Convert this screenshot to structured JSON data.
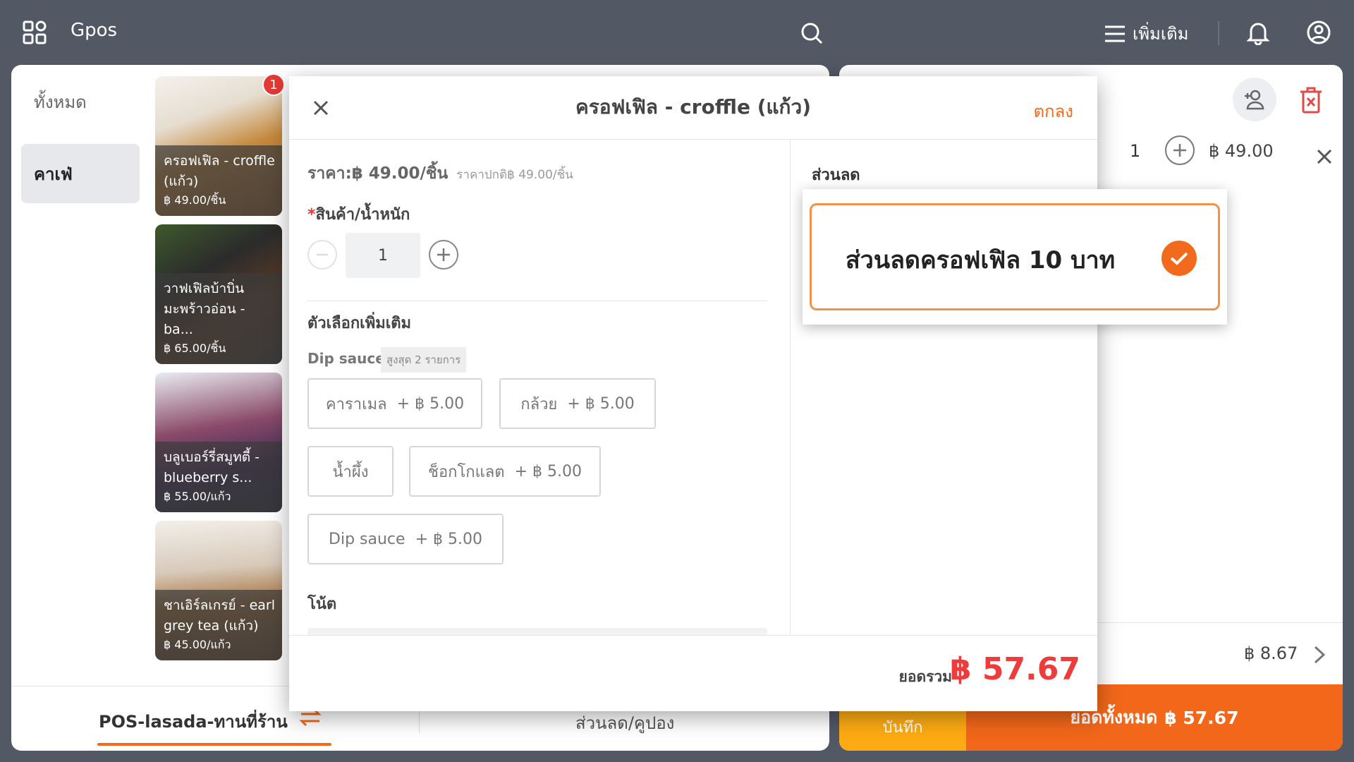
{
  "topbar": {
    "app_name": "Gpos",
    "more_label": "เพิ่มเติม"
  },
  "categories": [
    {
      "label": "ทั้งหมด"
    },
    {
      "label": "คาเฟ่"
    }
  ],
  "products": [
    {
      "name": "ครอฟเฟิล - croffle (แก้ว)",
      "price": "฿ 49.00/ชิ้น",
      "badge": "1"
    },
    {
      "name": "วาฟเฟิลบ้าบิ่นมะพร้าวอ่อน - ba...",
      "price": "฿ 65.00/ชิ้น"
    },
    {
      "name": "บลูเบอร์รี่สมูทตี้ - blueberry s...",
      "price": "฿ 55.00/แก้ว"
    },
    {
      "name": "ชาเอิร์ลเกรย์ - earl grey tea (แก้ว)",
      "price": "฿ 45.00/แก้ว"
    }
  ],
  "bottom_tabs": {
    "pos_channel": "POS-lasada-ทานที่ร้าน",
    "discount_tab": "ส่วนลด/คูปอง"
  },
  "cart": {
    "qty": "1",
    "item_price": "฿ 49.00",
    "subtotal": "฿ 8.67",
    "save_label": "บันทึก",
    "total_label": "ยอดทั้งหมด",
    "total_value": "฿ 57.67"
  },
  "dialog": {
    "title": "ครอฟเฟิล - croffle (แก้ว)",
    "ok_label": "ตกลง",
    "price_text": "ราคา:฿ 49.00/ชิ้น",
    "normal_price_text": "ราคาปกติ฿ 49.00/ชิ้น",
    "qty_required_mark": "*",
    "qty_label": "สินค้า/น้ำหนัก",
    "qty_value": "1",
    "options_title": "ตัวเลือกเพิ่มเติม",
    "option_group_name": "Dip sauce",
    "option_group_max": "สูงสุด 2 รายการ",
    "options": [
      {
        "name": "คาราเมล",
        "price": "+ ฿ 5.00"
      },
      {
        "name": "กล้วย",
        "price": "+ ฿ 5.00"
      },
      {
        "name": "น้ำผึ้ง",
        "price": ""
      },
      {
        "name": "ช็อกโกแลต",
        "price": "+ ฿ 5.00"
      },
      {
        "name": "Dip sauce",
        "price": "+ ฿ 5.00"
      }
    ],
    "note_label": "โน้ต",
    "discount_label": "ส่วนลด",
    "total_label": "ยอดรวม",
    "total_value": "฿ 57.67"
  },
  "discount_popup": {
    "name": "ส่วนลดครอฟเฟิล 10 บาท",
    "selected": true
  },
  "colors": {
    "accent": "#f26a1b",
    "topbar": "#525965",
    "save_button": "#fdab12",
    "total_red": "#ee3b3b"
  }
}
